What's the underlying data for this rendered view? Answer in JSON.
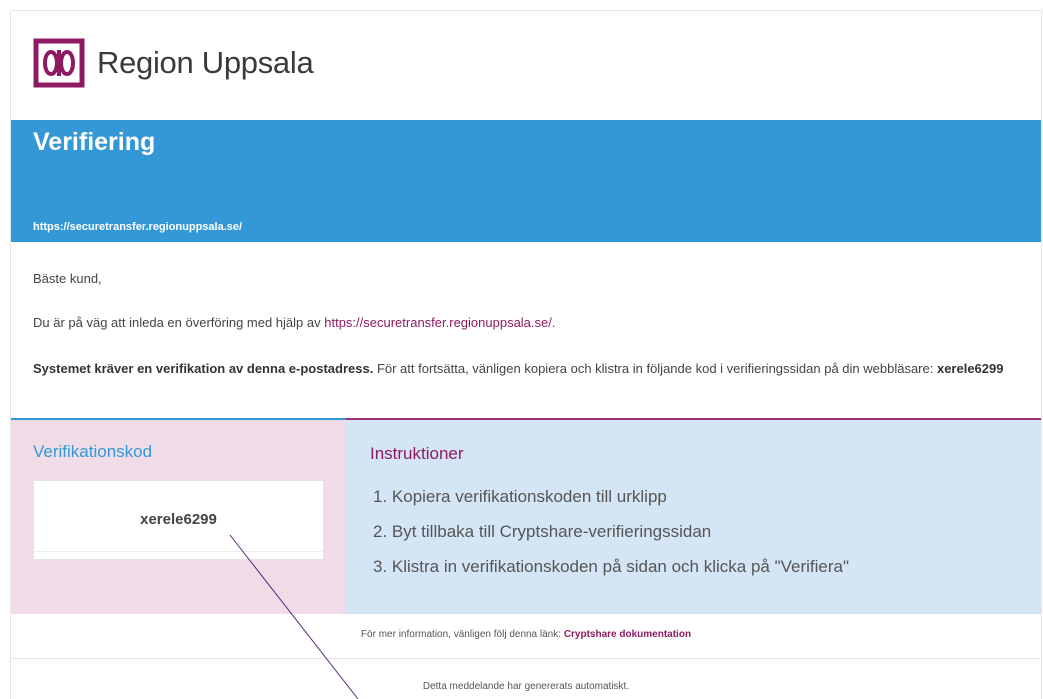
{
  "header": {
    "brand_name": "Region Uppsala",
    "brand_color": "#8e1a63"
  },
  "banner": {
    "title": "Verifiering",
    "url": "https://securetransfer.regionuppsala.se/",
    "color": "#3498d6"
  },
  "message": {
    "greeting": "Bäste kund,",
    "intro_prefix": "Du är på väg att inleda en överföring med hjälp av ",
    "intro_link": "https://securetransfer.regionuppsala.se/",
    "intro_suffix": ".",
    "required_bold": "Systemet kräver en verifikation av denna e-postadress.",
    "required_rest": " För att fortsätta, vänligen kopiera och klistra in följande kod i verifieringssidan på din webbläsare: ",
    "required_code": "xerele6299"
  },
  "verification": {
    "title": "Verifikationskod",
    "code": "xerele6299"
  },
  "instructions": {
    "title": "Instruktioner",
    "steps": [
      "1. Kopiera verifikationskoden till urklipp",
      "2. Byt tillbaka till Cryptshare-verifieringssidan",
      "3. Klistra in verifikationskoden på sidan och klicka på \"Verifiera\""
    ]
  },
  "footer": {
    "info_prefix": "För mer information, vänligen följ denna länk: ",
    "info_link": "Cryptshare dokumentation",
    "auto_note": "Detta meddelande har genererats automatiskt."
  }
}
